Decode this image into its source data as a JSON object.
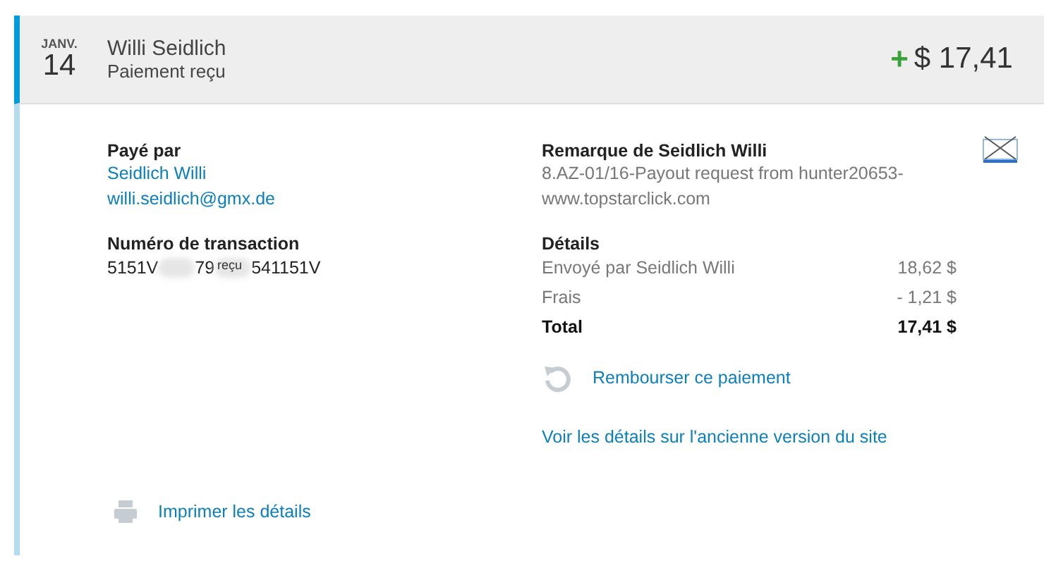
{
  "header": {
    "month": "JANV.",
    "day": "14",
    "name": "Willi Seidlich",
    "status": "Paiement reçu",
    "sign": "+",
    "amount": "$ 17,41"
  },
  "paid_by": {
    "label": "Payé par",
    "name": "Seidlich Willi",
    "email": "willi.seidlich@gmx.de"
  },
  "transaction": {
    "label": "Numéro de transaction",
    "value_parts": [
      "5151V",
      "79",
      "541151V"
    ],
    "overlay": "reçu"
  },
  "note": {
    "label": "Remarque de Seidlich Willi",
    "text": "8.AZ-01/16-Payout request from hunter20653-www.topstarclick.com"
  },
  "details": {
    "label": "Détails",
    "rows": [
      {
        "label": "Envoyé par Seidlich Willi",
        "value": "18,62 $",
        "kind": "line"
      },
      {
        "label": "Frais",
        "value": "- 1,21 $",
        "kind": "line"
      },
      {
        "label": "Total",
        "value": "17,41 $",
        "kind": "total"
      }
    ]
  },
  "refund_link": "Rembourser ce paiement",
  "old_version_link": "Voir les détails sur l'ancienne version du site",
  "print_link": "Imprimer les détails"
}
